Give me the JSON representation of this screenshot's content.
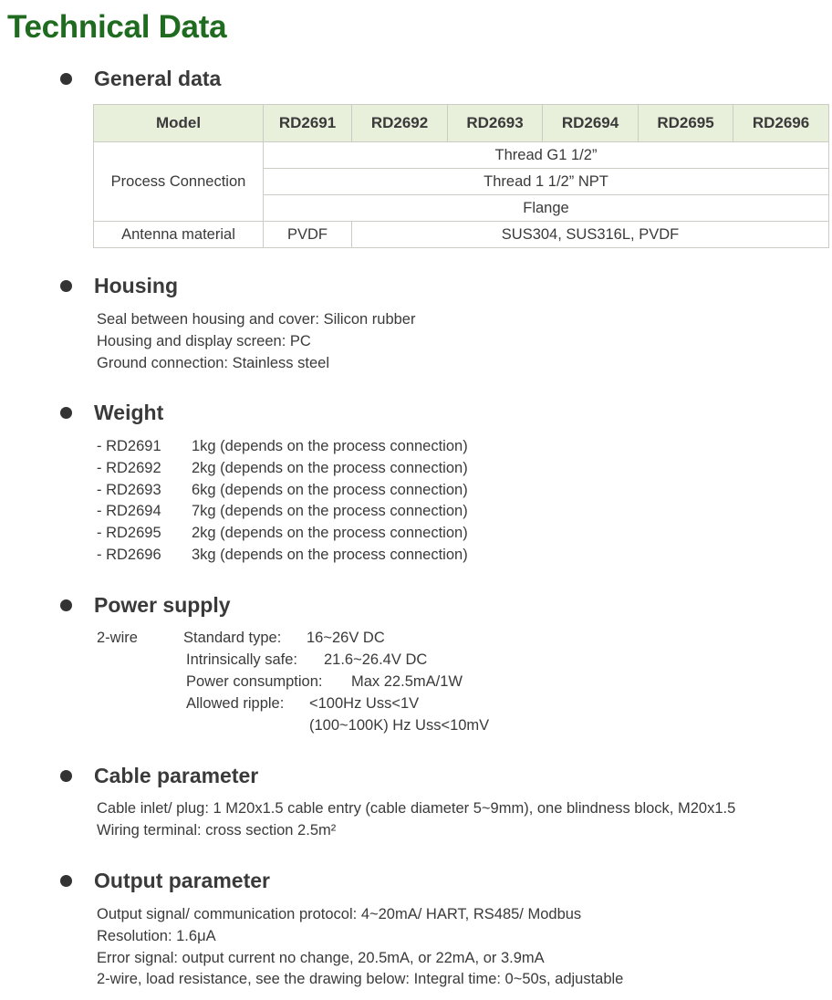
{
  "page_title": "Technical Data",
  "general": {
    "title": "General data",
    "table": {
      "header_model": "Model",
      "models": [
        "RD2691",
        "RD2692",
        "RD2693",
        "RD2694",
        "RD2695",
        "RD2696"
      ],
      "process_connection_label": "Process Connection",
      "process_connection_rows": [
        "Thread G1 1/2”",
        "Thread 1 1/2” NPT",
        "Flange"
      ],
      "antenna_label": "Antenna material",
      "antenna_first": "PVDF",
      "antenna_rest": "SUS304, SUS316L, PVDF"
    }
  },
  "housing": {
    "title": "Housing",
    "lines": [
      "Seal between housing and cover: Silicon rubber",
      "Housing and display screen: PC",
      "Ground connection: Stainless steel"
    ]
  },
  "weight": {
    "title": "Weight",
    "rows": [
      {
        "model": "- RD2691",
        "value": "1kg (depends on the process connection)"
      },
      {
        "model": "- RD2692",
        "value": "2kg (depends on the process connection)"
      },
      {
        "model": "- RD2693",
        "value": "6kg (depends on the process connection)"
      },
      {
        "model": "- RD2694",
        "value": "7kg (depends on the process connection)"
      },
      {
        "model": "- RD2695",
        "value": "2kg (depends on the process connection)"
      },
      {
        "model": "- RD2696",
        "value": "3kg (depends on the process connection)"
      }
    ]
  },
  "power": {
    "title": "Power supply",
    "wire": "2-wire",
    "standard_label": "Standard type:",
    "standard_value": "16~26V DC",
    "intrinsic_label": "Intrinsically safe:",
    "intrinsic_value": "21.6~26.4V DC",
    "consumption_label": "Power consumption:",
    "consumption_value": "Max 22.5mA/1W",
    "ripple_label": "Allowed ripple:",
    "ripple_value_1": "<100Hz Uss<1V",
    "ripple_value_2": "(100~100K) Hz Uss<10mV"
  },
  "cable": {
    "title": "Cable parameter",
    "lines": [
      "Cable inlet/ plug: 1 M20x1.5 cable entry (cable diameter 5~9mm), one blindness block, M20x1.5",
      "Wiring terminal: cross section 2.5m²"
    ]
  },
  "output": {
    "title": "Output parameter",
    "lines": [
      "Output signal/ communication protocol: 4~20mA/ HART, RS485/ Modbus",
      "Resolution: 1.6μA",
      "Error signal: output current no change, 20.5mA, or 22mA, or 3.9mA",
      "2-wire, load resistance, see the drawing below: Integral time: 0~50s, adjustable"
    ]
  }
}
